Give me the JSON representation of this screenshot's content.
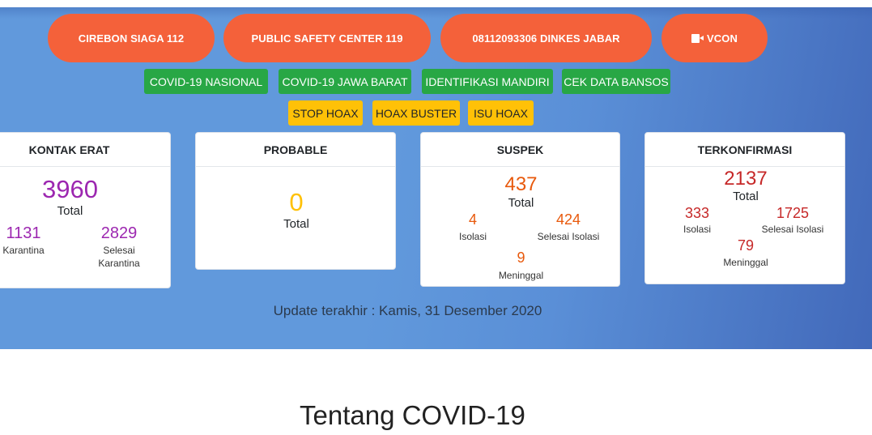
{
  "emergency_buttons": [
    {
      "label": "CIREBON SIAGA 112",
      "icon": null
    },
    {
      "label": "PUBLIC SAFETY CENTER 119",
      "icon": null
    },
    {
      "label": "08112093306 DINKES JABAR",
      "icon": null
    },
    {
      "label": "VCON",
      "icon": "video-camera-icon"
    }
  ],
  "info_links": [
    "COVID-19 NASIONAL",
    "COVID-19 JAWA BARAT",
    "IDENTIFIKASI MANDIRI",
    "CEK DATA BANSOS"
  ],
  "hoax_links": [
    "STOP HOAX",
    "HOAX BUSTER",
    "ISU HOAX"
  ],
  "colors": {
    "emergency": "#f4613a",
    "info": "#28a745",
    "hoax": "#ffc107",
    "kontak_erat": "#9c27b0",
    "probable": "#ffc107",
    "suspek": "#e8590c",
    "terkonfirmasi": "#c62828"
  },
  "stats": {
    "kontak_erat": {
      "title": "KONTAK ERAT",
      "total": "3960",
      "total_label": "Total",
      "karantina": "1131",
      "karantina_label": "Karantina",
      "selesai": "2829",
      "selesai_label_1": "Selesai",
      "selesai_label_2": "Karantina"
    },
    "probable": {
      "title": "PROBABLE",
      "total": "0",
      "total_label": "Total"
    },
    "suspek": {
      "title": "SUSPEK",
      "total": "437",
      "total_label": "Total",
      "isolasi": "4",
      "isolasi_label": "Isolasi",
      "selesai": "424",
      "selesai_label": "Selesai Isolasi",
      "meninggal": "9",
      "meninggal_label": "Meninggal"
    },
    "terkonfirmasi": {
      "title": "TERKONFIRMASI",
      "total": "2137",
      "total_label": "Total",
      "isolasi": "333",
      "isolasi_label": "Isolasi",
      "selesai": "1725",
      "selesai_label": "Selesai Isolasi",
      "meninggal": "79",
      "meninggal_label": "Meninggal"
    }
  },
  "update_text": "Update terakhir : Kamis, 31 Desember 2020",
  "section_title": "Tentang COVID-19"
}
